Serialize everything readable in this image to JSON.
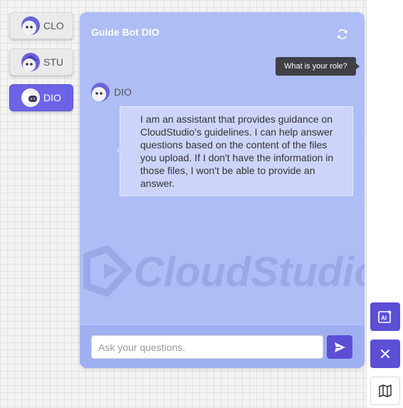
{
  "bots": [
    {
      "label": "CLO",
      "active": false
    },
    {
      "label": "STU",
      "active": false
    },
    {
      "label": "DIO",
      "active": true
    }
  ],
  "chat": {
    "title": "Guide Bot DIO",
    "watermark_text": "CloudStudio",
    "user_message": "What is your role?",
    "bot_name": "DIO",
    "bot_message": "I am an assistant that provides guidance on CloudStudio's guidelines. I can help answer questions based on the content of the files you upload. If I don't have the information in those files, I won't be able to provide an answer.",
    "input_placeholder": "Ask your questions.",
    "input_value": ""
  },
  "icons": {
    "refresh": "refresh-icon",
    "send": "send-icon",
    "ai_image": "ai-image-icon",
    "close": "close-icon",
    "map": "map-icon"
  },
  "colors": {
    "accent": "#5b4fd6",
    "active_tab": "#6d63e6",
    "panel": "#aebdf5",
    "bot_bubble": "#ccd5f9",
    "user_bubble": "#3f3f46"
  }
}
